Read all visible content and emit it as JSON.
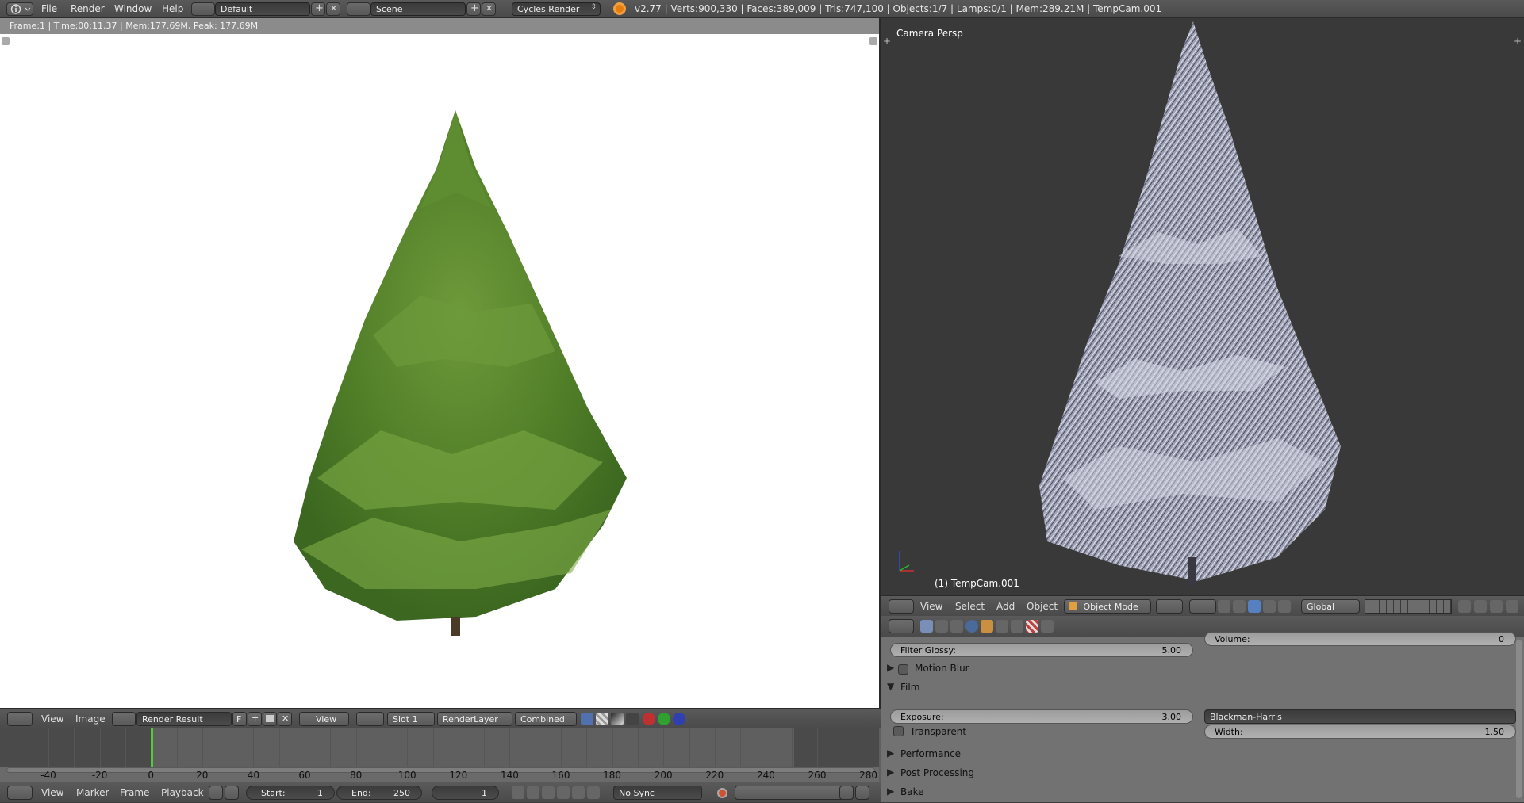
{
  "topbar": {
    "menus": [
      "File",
      "Render",
      "Window",
      "Help"
    ],
    "layout": "Default",
    "scene": "Scene",
    "engine": "Cycles Render",
    "stats": "v2.77 | Verts:900,330 | Faces:389,009 | Tris:747,100 | Objects:1/7 | Lamps:0/1 | Mem:289.21M | TempCam.001"
  },
  "image_editor": {
    "render_info": "Frame:1 | Time:00:11.37 | Mem:177.69M, Peak: 177.69M",
    "header": {
      "menus": [
        "View",
        "Image"
      ],
      "image_name": "Render Result",
      "fake_user": "F",
      "view": "View",
      "slot": "Slot 1",
      "layer": "RenderLayer",
      "pass": "Combined"
    }
  },
  "timeline": {
    "ticks": [
      "-40",
      "-20",
      "0",
      "20",
      "40",
      "60",
      "80",
      "100",
      "120",
      "140",
      "160",
      "180",
      "200",
      "220",
      "240",
      "260",
      "280"
    ],
    "header": {
      "menus": [
        "View",
        "Marker",
        "Frame",
        "Playback"
      ],
      "start_label": "Start:",
      "start_value": "1",
      "end_label": "End:",
      "end_value": "250",
      "current_frame": "1",
      "sync": "No Sync"
    }
  },
  "view3d": {
    "title": "Camera Persp",
    "object_label": "(1) TempCam.001",
    "header": {
      "menus": [
        "View",
        "Select",
        "Add",
        "Object"
      ],
      "mode": "Object Mode",
      "orientation": "Global"
    }
  },
  "properties": {
    "filter_glossy_label": "Filter Glossy:",
    "filter_glossy_value": "5.00",
    "volume_label": "Volume:",
    "volume_value": "0",
    "panels": {
      "motion_blur": "Motion Blur",
      "film": "Film",
      "performance": "Performance",
      "post_processing": "Post Processing",
      "bake": "Bake"
    },
    "exposure_label": "Exposure:",
    "exposure_value": "3.00",
    "filter_type": "Blackman-Harris",
    "width_label": "Width:",
    "width_value": "1.50",
    "transparent_label": "Transparent"
  },
  "colors": {
    "playhead": "#55c93a",
    "tree_green": "#5b8a2f",
    "wire_tree": "#c9ccdb"
  }
}
